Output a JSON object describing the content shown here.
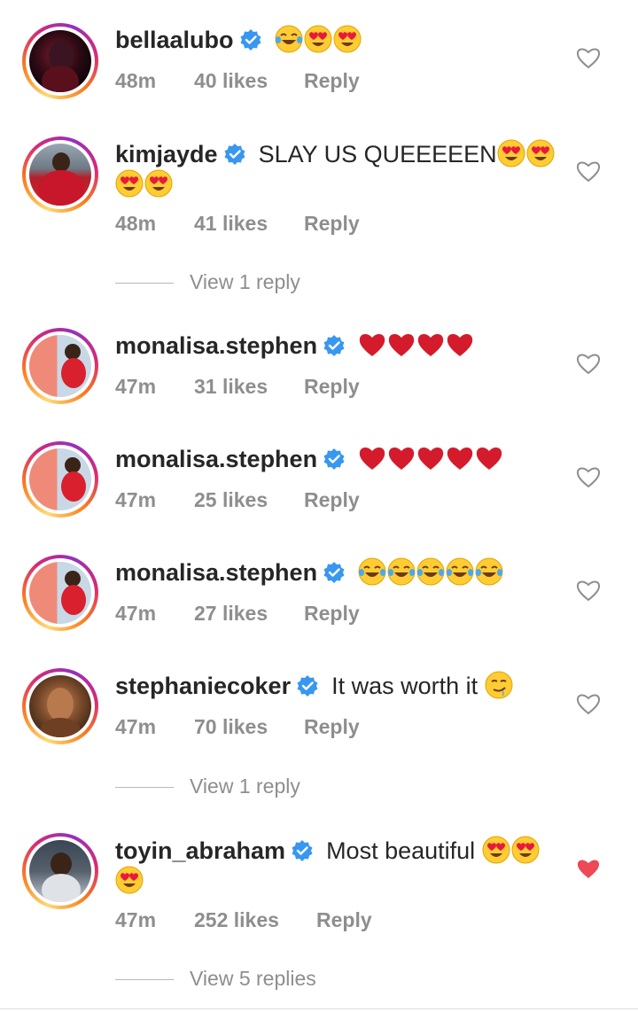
{
  "comments": [
    {
      "username": "bellaalubo",
      "text": "",
      "emojis": [
        "laugh",
        "love",
        "love"
      ],
      "time": "48m",
      "likes": "40 likes",
      "reply": "Reply",
      "liked": false
    },
    {
      "username": "kimjayde",
      "text": "SLAY US QUEEEEEN",
      "emojis": [
        "love",
        "love"
      ],
      "emojis2": [
        "love",
        "love"
      ],
      "time": "48m",
      "likes": "41 likes",
      "reply": "Reply",
      "liked": false,
      "view_replies": "View 1 reply"
    },
    {
      "username": "monalisa.stephen",
      "text": "",
      "emojis": [
        "heart",
        "heart",
        "heart",
        "heart"
      ],
      "time": "47m",
      "likes": "31 likes",
      "reply": "Reply",
      "liked": false
    },
    {
      "username": "monalisa.stephen",
      "text": "",
      "emojis": [
        "heart",
        "heart",
        "heart",
        "heart",
        "heart"
      ],
      "time": "47m",
      "likes": "25 likes",
      "reply": "Reply",
      "liked": false
    },
    {
      "username": "monalisa.stephen",
      "text": "",
      "emojis": [
        "laugh",
        "laugh",
        "laugh",
        "laugh",
        "laugh"
      ],
      "time": "47m",
      "likes": "27 likes",
      "reply": "Reply",
      "liked": false
    },
    {
      "username": "stephaniecoker",
      "text": "It was worth it",
      "emojis": [
        "drool"
      ],
      "time": "47m",
      "likes": "70 likes",
      "reply": "Reply",
      "liked": false,
      "view_replies": "View 1 reply"
    },
    {
      "username": "toyin_abraham",
      "text": "Most beautiful",
      "emojis": [
        "love",
        "love"
      ],
      "emojis2": [
        "love"
      ],
      "time": "47m",
      "likes": "252 likes",
      "reply": "Reply",
      "liked": true,
      "view_replies": "View 5 replies"
    }
  ],
  "colors": {
    "verified": "#3897f0",
    "liked_heart": "#ed4956",
    "muted": "#8e8e8e"
  }
}
